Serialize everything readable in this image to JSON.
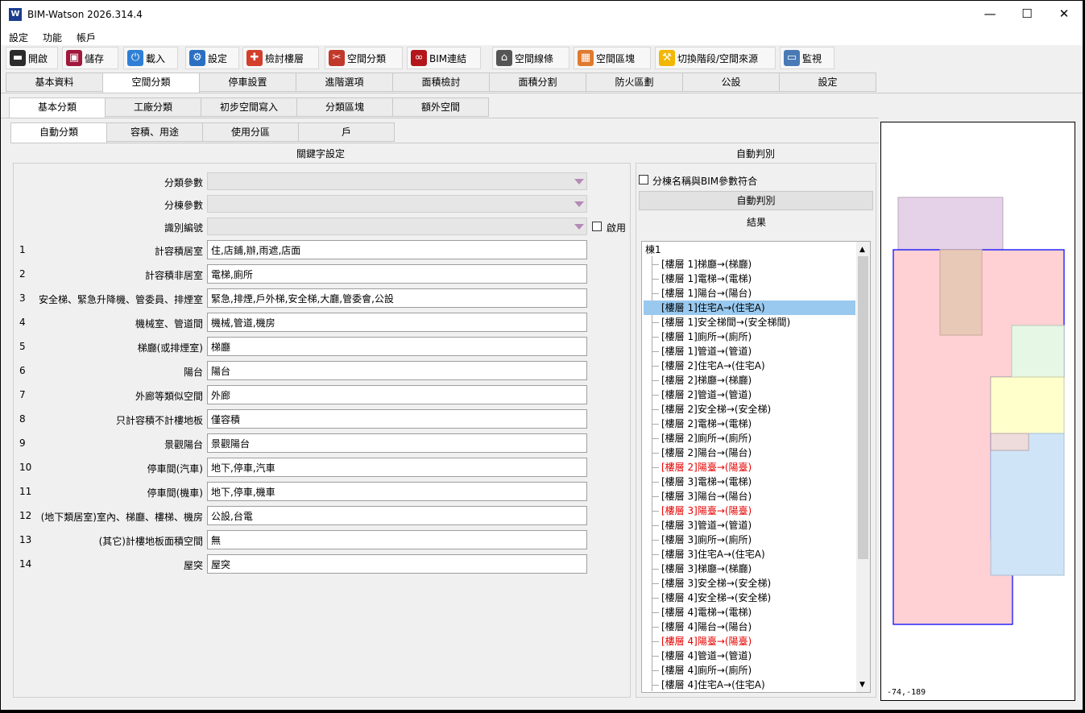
{
  "window": {
    "title": "BIM-Watson 2026.314.4",
    "logo_glyph": "W",
    "minimize": "—",
    "maximize": "☐",
    "close": "✕"
  },
  "menu": [
    "設定",
    "功能",
    "帳戶"
  ],
  "toolbar": [
    {
      "label": "開啟",
      "icon": "folder-icon",
      "color": "#2b2b2b",
      "glyph": "▬"
    },
    {
      "label": "儲存",
      "icon": "save-icon",
      "color": "#a0183c",
      "glyph": "▣"
    },
    {
      "label": "載入",
      "icon": "power-icon",
      "color": "#2f7fd6",
      "glyph": "⏻"
    },
    {
      "label": "設定",
      "icon": "gears-icon",
      "color": "#2b6fc2",
      "glyph": "⚙"
    },
    {
      "label": "檢討樓層",
      "icon": "puzzle-icon",
      "color": "#d33f2b",
      "glyph": "✚"
    },
    {
      "label": "空間分類",
      "icon": "tools-icon",
      "color": "#c0392b",
      "glyph": "✂"
    },
    {
      "label": "BIM連結",
      "icon": "link-icon",
      "color": "#b3161b",
      "glyph": "∞"
    },
    {
      "label": "空間線條",
      "icon": "house-icon",
      "color": "#555555",
      "glyph": "⌂"
    },
    {
      "label": "空間區塊",
      "icon": "blocks-icon",
      "color": "#e07a2e",
      "glyph": "▦"
    },
    {
      "label": "切換階段/空間來源",
      "icon": "switch-icon",
      "color": "#f2b705",
      "glyph": "⚒"
    },
    {
      "label": "監視",
      "icon": "monitor-icon",
      "color": "#4a7ab5",
      "glyph": "▭"
    }
  ],
  "tabs_main": [
    "基本資料",
    "空間分類",
    "停車設置",
    "進階選項",
    "面積檢討",
    "面積分割",
    "防火區劃",
    "公設",
    "設定"
  ],
  "tabs_sub": [
    "基本分類",
    "工廠分類",
    "初步空間寫入",
    "分類區塊",
    "額外空間"
  ],
  "tabs_sub2": [
    "自動分類",
    "容積、用途",
    "使用分區",
    "戶"
  ],
  "keyword_title": "關鍵字設定",
  "combos": [
    {
      "label": "分類參數",
      "value": ""
    },
    {
      "label": "分棟參數",
      "value": ""
    },
    {
      "label": "識別編號",
      "value": ""
    }
  ],
  "enable_label": "啟用",
  "keywords": [
    {
      "n": "1",
      "label": "計容積居室",
      "value": "住,店鋪,辦,雨遮,店面"
    },
    {
      "n": "2",
      "label": "計容積非居室",
      "value": "電梯,廁所"
    },
    {
      "n": "3",
      "label": "安全梯、緊急升降機、管委員、排煙室",
      "value": "緊急,排煙,戶外梯,安全梯,大廳,管委會,公設"
    },
    {
      "n": "4",
      "label": "機械室、管道間",
      "value": "機械,管道,機房"
    },
    {
      "n": "5",
      "label": "梯廳(或排煙室)",
      "value": "梯廳"
    },
    {
      "n": "6",
      "label": "陽台",
      "value": "陽台"
    },
    {
      "n": "7",
      "label": "外廊等類似空間",
      "value": "外廊"
    },
    {
      "n": "8",
      "label": "只計容積不計樓地板",
      "value": "僅容積"
    },
    {
      "n": "9",
      "label": "景觀陽台",
      "value": "景觀陽台"
    },
    {
      "n": "10",
      "label": "停車間(汽車)",
      "value": "地下,停車,汽車"
    },
    {
      "n": "11",
      "label": "停車間(機車)",
      "value": "地下,停車,機車"
    },
    {
      "n": "12",
      "label": "(地下類居室)室內、梯廳、樓梯、機房",
      "value": "公設,台電"
    },
    {
      "n": "13",
      "label": "(其它)計樓地板面積空間",
      "value": "無"
    },
    {
      "n": "14",
      "label": "屋突",
      "value": "屋突"
    }
  ],
  "auto": {
    "title": "自動判別",
    "match_label": "分棟名稱與BIM參數符合",
    "button": "自動判別",
    "result_title": "結果"
  },
  "tree": {
    "root": "棟1",
    "items": [
      {
        "t": "[樓層 1]梯廳→(梯廳)",
        "s": ""
      },
      {
        "t": "[樓層 1]電梯→(電梯)",
        "s": ""
      },
      {
        "t": "[樓層 1]陽台→(陽台)",
        "s": ""
      },
      {
        "t": "[樓層 1]住宅A→(住宅A)",
        "s": "sel"
      },
      {
        "t": "[樓層 1]安全梯間→(安全梯間)",
        "s": ""
      },
      {
        "t": "[樓層 1]廁所→(廁所)",
        "s": ""
      },
      {
        "t": "[樓層 1]管道→(管道)",
        "s": ""
      },
      {
        "t": "[樓層 2]住宅A→(住宅A)",
        "s": ""
      },
      {
        "t": "[樓層 2]梯廳→(梯廳)",
        "s": ""
      },
      {
        "t": "[樓層 2]管道→(管道)",
        "s": ""
      },
      {
        "t": "[樓層 2]安全梯→(安全梯)",
        "s": ""
      },
      {
        "t": "[樓層 2]電梯→(電梯)",
        "s": ""
      },
      {
        "t": "[樓層 2]廁所→(廁所)",
        "s": ""
      },
      {
        "t": "[樓層 2]陽台→(陽台)",
        "s": ""
      },
      {
        "t": "[樓層 2]陽臺→(陽臺)",
        "s": "red"
      },
      {
        "t": "[樓層 3]電梯→(電梯)",
        "s": ""
      },
      {
        "t": "[樓層 3]陽台→(陽台)",
        "s": ""
      },
      {
        "t": "[樓層 3]陽臺→(陽臺)",
        "s": "red"
      },
      {
        "t": "[樓層 3]管道→(管道)",
        "s": ""
      },
      {
        "t": "[樓層 3]廁所→(廁所)",
        "s": ""
      },
      {
        "t": "[樓層 3]住宅A→(住宅A)",
        "s": ""
      },
      {
        "t": "[樓層 3]梯廳→(梯廳)",
        "s": ""
      },
      {
        "t": "[樓層 3]安全梯→(安全梯)",
        "s": ""
      },
      {
        "t": "[樓層 4]安全梯→(安全梯)",
        "s": ""
      },
      {
        "t": "[樓層 4]電梯→(電梯)",
        "s": ""
      },
      {
        "t": "[樓層 4]陽台→(陽台)",
        "s": ""
      },
      {
        "t": "[樓層 4]陽臺→(陽臺)",
        "s": "red"
      },
      {
        "t": "[樓層 4]管道→(管道)",
        "s": ""
      },
      {
        "t": "[樓層 4]廁所→(廁所)",
        "s": ""
      },
      {
        "t": "[樓層 4]住宅A→(住宅A)",
        "s": ""
      }
    ]
  },
  "canvas": {
    "coord": "-74,-189"
  },
  "colors": {
    "selection": "#99c9ef",
    "warning_text": "#e60000",
    "outline": "#0000ff"
  }
}
